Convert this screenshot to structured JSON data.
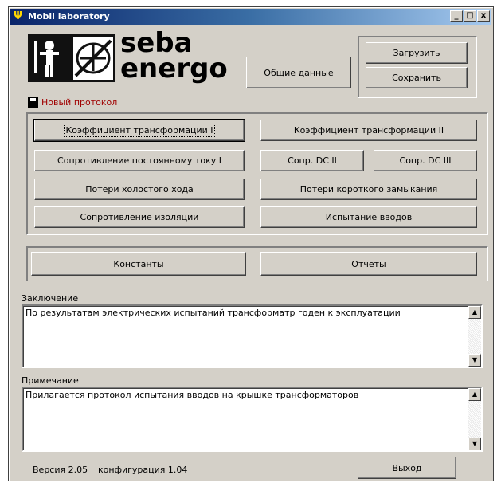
{
  "window": {
    "title": "Mobil laboratory",
    "app_icon": "trident-icon",
    "controls": {
      "minimize": "_",
      "maximize": "□",
      "close": "x"
    }
  },
  "branding": {
    "line1": "seba",
    "line2": "energo",
    "logo_icons": [
      "worker-icon",
      "transformer-icon"
    ]
  },
  "header_buttons": {
    "general_data": "Общие данные",
    "load": "Загрузить",
    "save": "Сохранить"
  },
  "new_protocol": {
    "label": "Новый протокол",
    "icon": "floppy-disk-icon",
    "color": "#a00000"
  },
  "tests": {
    "coef_transform_1": "Коэффициент трансформации I",
    "coef_transform_2": "Коэффициент трансформации II",
    "dc_resistance_1": "Сопротивление постоянному току I",
    "dc_resistance_2": "Сопр. DC II",
    "dc_resistance_3": "Сопр. DC III",
    "noload_loss": "Потери холостого хода",
    "shortcircuit_loss": "Потери короткого замыкания",
    "insulation_resistance": "Сопротивление изоляции",
    "bushing_test": "Испытание вводов"
  },
  "extras": {
    "constants": "Константы",
    "reports": "Отчеты"
  },
  "conclusion": {
    "label": "Заключение",
    "text": "По результатам электрических испытаний трансформатр годен к эксплуатации"
  },
  "notes": {
    "label": "Примечание",
    "text": "Прилагается протокол испытания вводов на крышке трансформаторов"
  },
  "footer": {
    "version": "Версия 2.05",
    "config": "конфигурация 1.04",
    "exit": "Выход"
  }
}
